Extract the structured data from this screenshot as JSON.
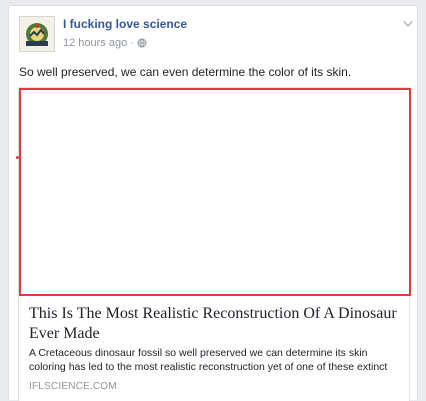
{
  "post": {
    "author": "I fucking love science",
    "timestamp": "12 hours ago",
    "separator": "·",
    "message": "So well preserved, we can even determine the color of its skin.",
    "audience_icon": "globe-icon",
    "options_icon": "chevron-down-icon"
  },
  "link_preview": {
    "title": "This Is The Most Realistic Reconstruction Of A Dinosaur Ever Made",
    "description": "A Cretaceous dinosaur fossil so well preserved we can determine its skin coloring has led to the most realistic reconstruction yet of one of these extinct",
    "domain": "IFLSCIENCE.COM",
    "image_border_color": "#e0393e"
  },
  "colors": {
    "link_blue": "#365899",
    "meta_gray": "#90949c",
    "text": "#1d2129",
    "page_bg": "#e9ebee"
  }
}
